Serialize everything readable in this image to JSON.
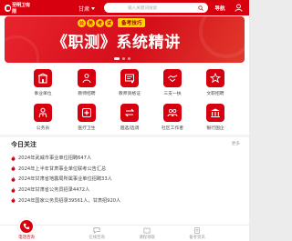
{
  "header": {
    "logo_text": "至明卫有限",
    "region": "甘肃",
    "search_placeholder": "输入关键词搜索",
    "nav_label": "导航"
  },
  "banner": {
    "badges": [
      "公",
      "务",
      "考",
      "试"
    ],
    "tips": "备考技巧",
    "title": "《职测》系统精讲"
  },
  "grid": [
    {
      "label": "事业单位",
      "icon": "building-icon"
    },
    {
      "label": "教师招聘",
      "icon": "teacher-icon"
    },
    {
      "label": "教师资格证",
      "icon": "certificate-icon"
    },
    {
      "label": "三支一扶",
      "icon": "handshake-icon"
    },
    {
      "label": "文职招聘",
      "icon": "military-icon"
    },
    {
      "label": "公务员",
      "icon": "official-icon"
    },
    {
      "label": "医疗卫生",
      "icon": "medical-icon"
    },
    {
      "label": "遴选/选调",
      "icon": "transfer-icon"
    },
    {
      "label": "社区工作者",
      "icon": "community-icon"
    },
    {
      "label": "银行国企",
      "icon": "bank-icon"
    }
  ],
  "news": {
    "title": "今日关注",
    "more": "更多",
    "items": [
      "2024年武威市事业单位招聘647人",
      "2024年上半年甘肃事业单位联考公告汇总",
      "2024年甘肃省地震局所属事业单位招聘33人",
      "2024年甘肃省公务员招录4472人",
      "2024年国家公务员招录39561人，甘肃招920人"
    ]
  },
  "tabbar": {
    "active": "电话咨询",
    "tabs": [
      "在线咨询",
      "课程领取",
      "备考资讯"
    ]
  },
  "colors": {
    "brand": "#d7000f",
    "badge": "#ffd400"
  }
}
